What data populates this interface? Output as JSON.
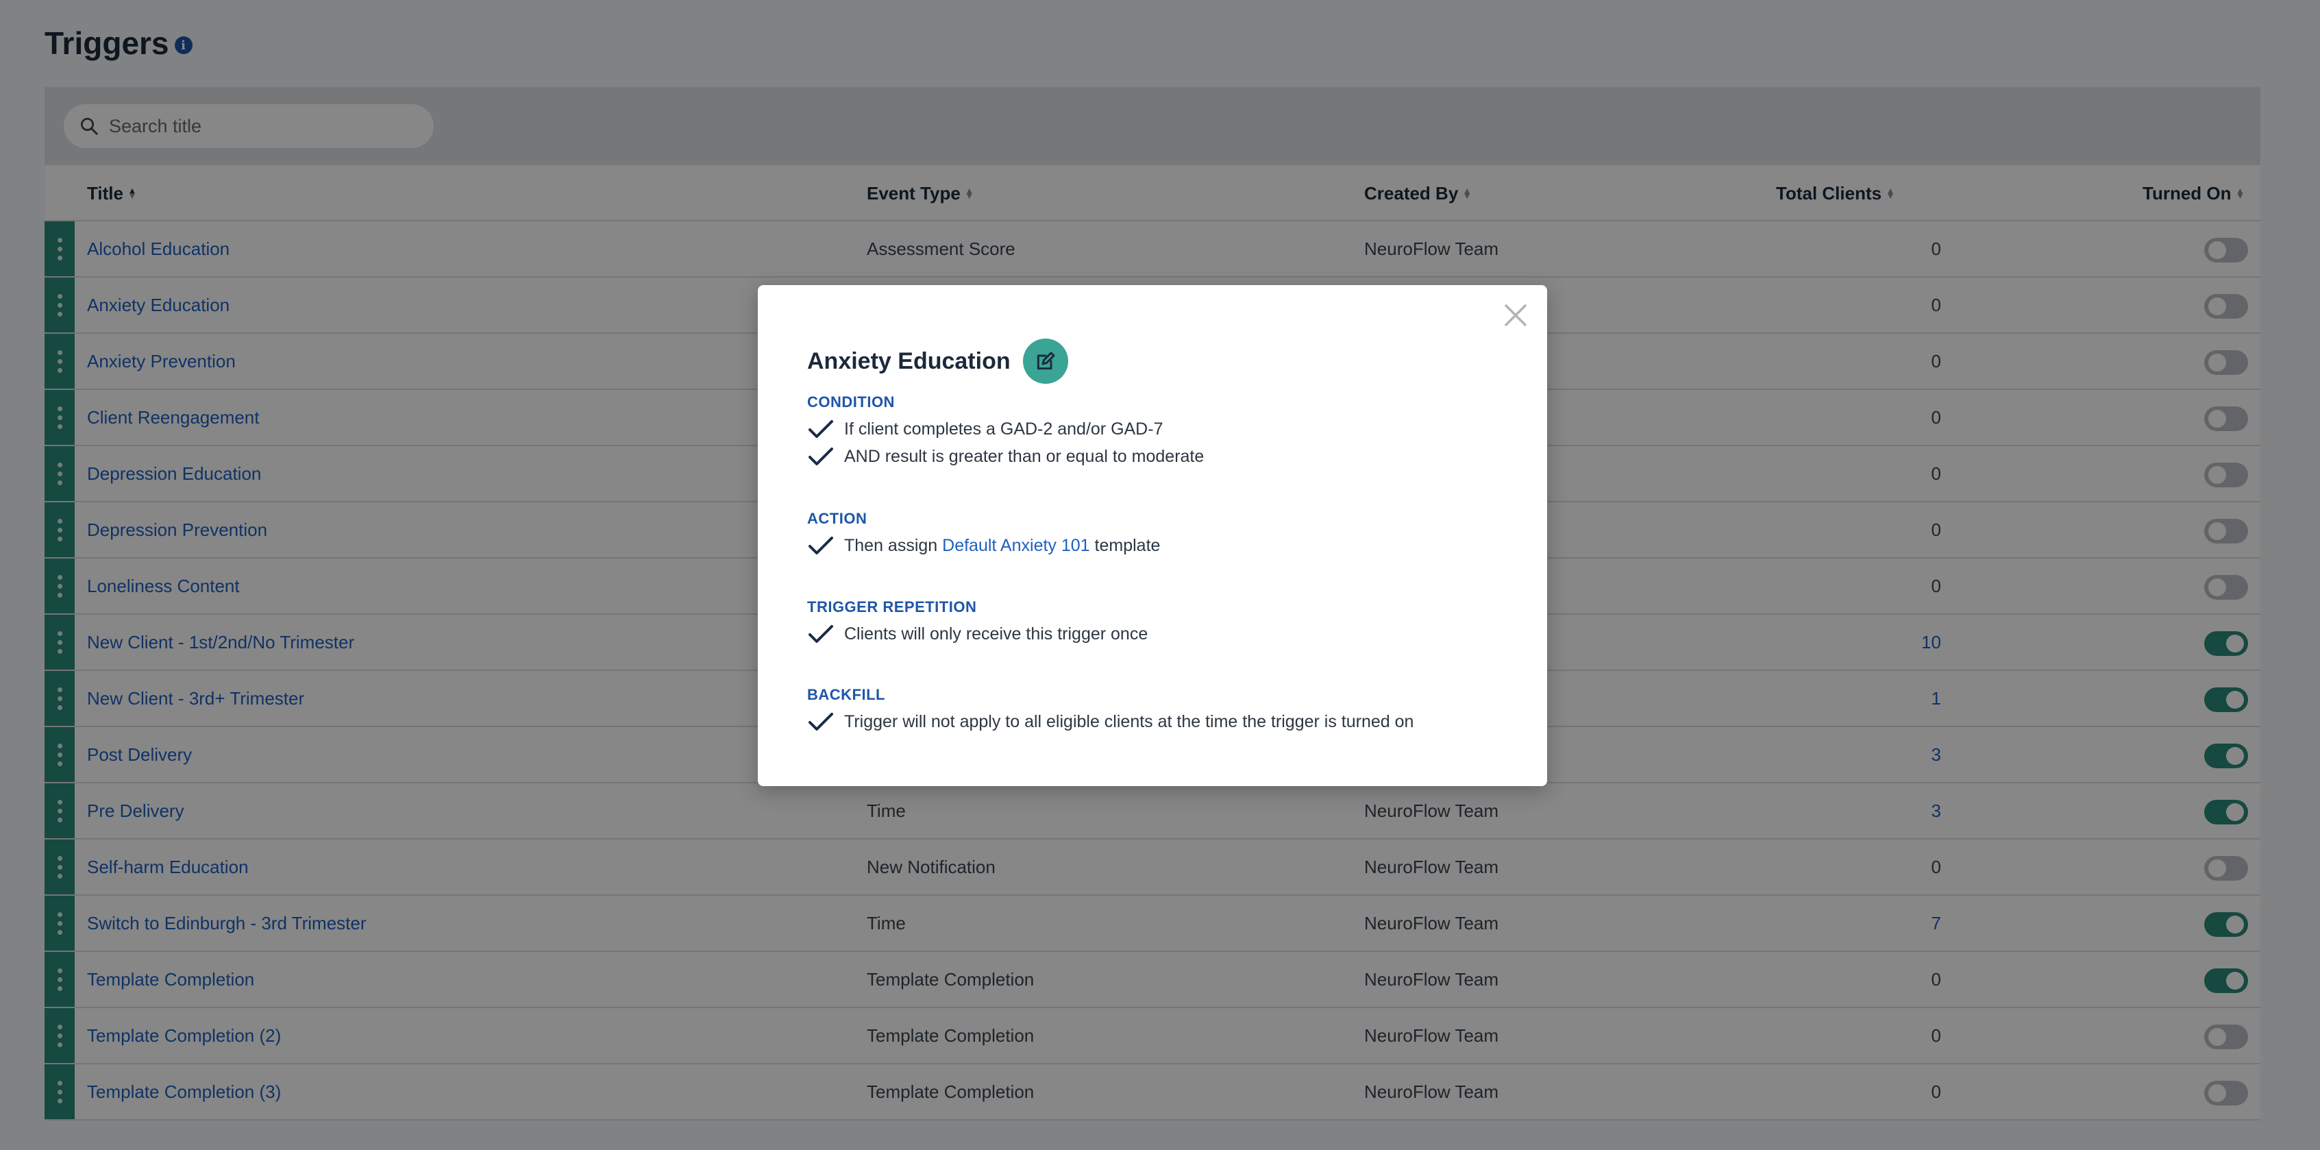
{
  "page": {
    "title": "Triggers",
    "info_glyph": "i"
  },
  "search": {
    "placeholder": "Search title"
  },
  "table": {
    "headers": {
      "title": "Title",
      "event_type": "Event Type",
      "created_by": "Created By",
      "total_clients": "Total Clients",
      "turned_on": "Turned On"
    },
    "rows": [
      {
        "title": "Alcohol Education",
        "event_type": "Assessment Score",
        "created_by": "NeuroFlow Team",
        "total_clients": "0",
        "turned_on": false
      },
      {
        "title": "Anxiety Education",
        "event_type": "",
        "created_by": "",
        "total_clients": "0",
        "turned_on": false
      },
      {
        "title": "Anxiety Prevention",
        "event_type": "",
        "created_by": "",
        "total_clients": "0",
        "turned_on": false
      },
      {
        "title": "Client Reengagement",
        "event_type": "",
        "created_by": "",
        "total_clients": "0",
        "turned_on": false
      },
      {
        "title": "Depression Education",
        "event_type": "",
        "created_by": "",
        "total_clients": "0",
        "turned_on": false
      },
      {
        "title": "Depression Prevention",
        "event_type": "",
        "created_by": "",
        "total_clients": "0",
        "turned_on": false
      },
      {
        "title": "Loneliness Content",
        "event_type": "",
        "created_by": "",
        "total_clients": "0",
        "turned_on": false
      },
      {
        "title": "New Client - 1st/2nd/No Trimester",
        "event_type": "",
        "created_by": "",
        "total_clients": "10",
        "turned_on": true
      },
      {
        "title": "New Client - 3rd+ Trimester",
        "event_type": "",
        "created_by": "",
        "total_clients": "1",
        "turned_on": true
      },
      {
        "title": "Post Delivery",
        "event_type": "",
        "created_by": "",
        "total_clients": "3",
        "turned_on": true
      },
      {
        "title": "Pre Delivery",
        "event_type": "Time",
        "created_by": "NeuroFlow Team",
        "total_clients": "3",
        "turned_on": true
      },
      {
        "title": "Self-harm Education",
        "event_type": "New Notification",
        "created_by": "NeuroFlow Team",
        "total_clients": "0",
        "turned_on": false
      },
      {
        "title": "Switch to Edinburgh - 3rd Trimester",
        "event_type": "Time",
        "created_by": "NeuroFlow Team",
        "total_clients": "7",
        "turned_on": true
      },
      {
        "title": "Template Completion",
        "event_type": "Template Completion",
        "created_by": "NeuroFlow Team",
        "total_clients": "0",
        "turned_on": true
      },
      {
        "title": "Template Completion (2)",
        "event_type": "Template Completion",
        "created_by": "NeuroFlow Team",
        "total_clients": "0",
        "turned_on": false
      },
      {
        "title": "Template Completion (3)",
        "event_type": "Template Completion",
        "created_by": "NeuroFlow Team",
        "total_clients": "0",
        "turned_on": false
      }
    ]
  },
  "modal": {
    "title": "Anxiety Education",
    "condition": {
      "heading": "CONDITION",
      "lines": [
        "If client completes a GAD-2 and/or GAD-7",
        "AND result is greater than or equal to moderate"
      ]
    },
    "action": {
      "heading": "ACTION",
      "prefix": "Then assign",
      "link": "Default Anxiety 101",
      "suffix": "template"
    },
    "repetition": {
      "heading": "TRIGGER REPETITION",
      "line": "Clients will only receive this trigger once"
    },
    "backfill": {
      "heading": "BACKFILL",
      "line": "Trigger will not apply to all eligible clients at the time the trigger is turned on"
    }
  },
  "icons": {
    "search": "search-icon",
    "info": "info-icon",
    "close": "close-icon",
    "edit": "edit-icon",
    "check": "check-icon",
    "drag": "drag-handle-icon"
  },
  "colors": {
    "accent_teal": "#2b8a78",
    "edit_teal": "#3aa495",
    "link_blue": "#1f5fbf",
    "heading_blue": "#1f56a8",
    "title_dark": "#1b2a3a"
  }
}
